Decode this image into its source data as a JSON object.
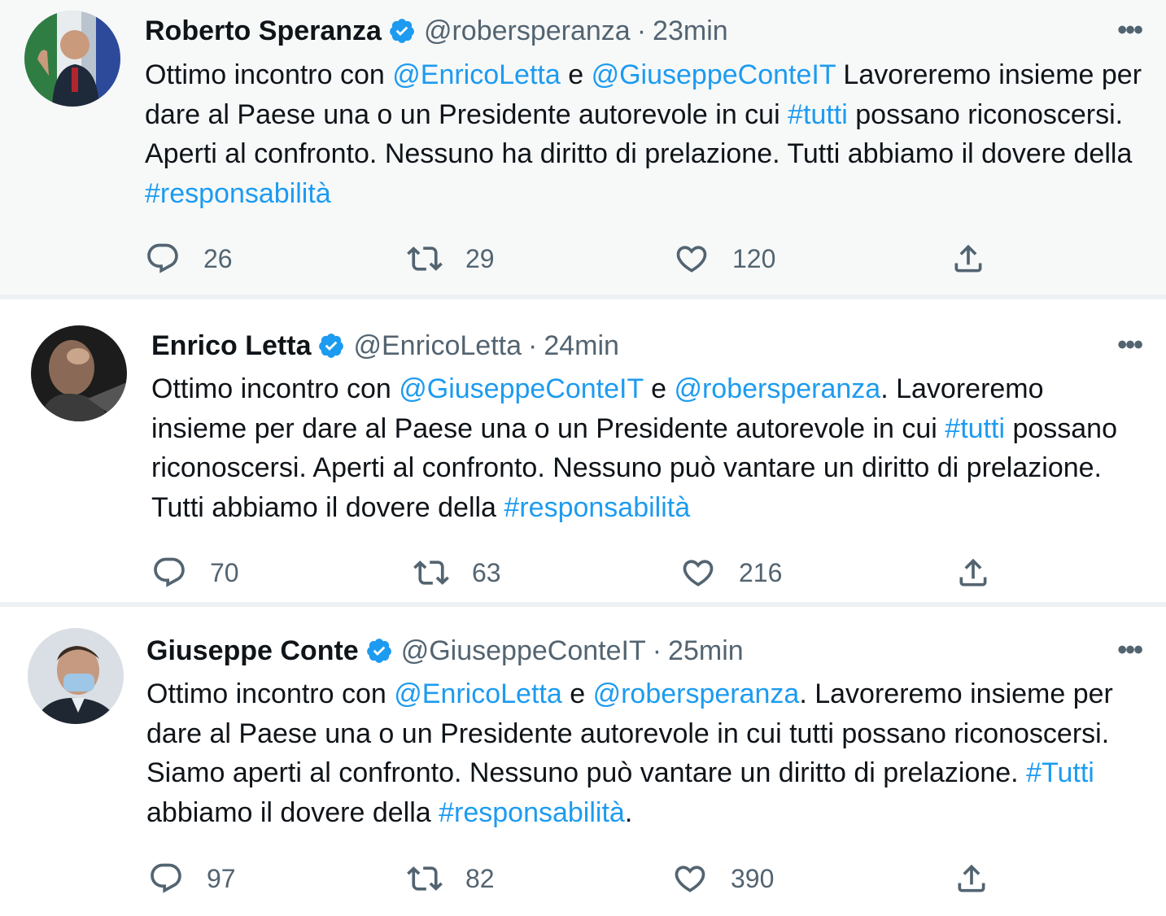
{
  "accent": "#1d9bf0",
  "tweets": [
    {
      "name": "Roberto Speranza",
      "handle": "@robersperanza",
      "separator": "·",
      "time": "23min",
      "text": {
        "p1": "Ottimo incontro con ",
        "l1": "@EnricoLetta",
        "p2": " e ",
        "l2": "@GiuseppeConteIT",
        "p3": " Lavoreremo insieme per dare al Paese una o un Presidente autorevole in cui ",
        "l3": "#tutti",
        "p4": " possano riconoscersi. Aperti al confronto. Nessuno ha diritto di prelazione. Tutti abbiamo il dovere della ",
        "l4": "#responsabilità",
        "p5": ""
      },
      "replies": "26",
      "retweets": "29",
      "likes": "120"
    },
    {
      "name": "Enrico Letta",
      "handle": "@EnricoLetta",
      "separator": "·",
      "time": "24min",
      "text": {
        "p1": "Ottimo incontro con ",
        "l1": "@GiuseppeConteIT",
        "p2": " e ",
        "l2": "@robersperanza",
        "p3": ". Lavoreremo insieme per dare al Paese una o un Presidente autorevole in cui ",
        "l3": "#tutti",
        "p4": " possano riconoscersi. Aperti al confronto. Nessuno può vantare un diritto di prelazione. Tutti abbiamo il dovere della ",
        "l4": "#responsabilità",
        "p5": ""
      },
      "replies": "70",
      "retweets": "63",
      "likes": "216"
    },
    {
      "name": "Giuseppe Conte",
      "handle": "@GiuseppeConteIT",
      "separator": "·",
      "time": "25min",
      "text": {
        "p1": "Ottimo incontro con ",
        "l1": "@EnricoLetta",
        "p2": " e ",
        "l2": "@robersperanza",
        "p3": ". Lavoreremo insieme per dare al Paese una o un Presidente autorevole in cui tutti possano riconoscersi. Siamo aperti al confronto. Nessuno può vantare un diritto di prelazione. ",
        "l3": "#Tutti",
        "p4": " abbiamo il dovere della ",
        "l4": "#responsabilità",
        "p5": "."
      },
      "replies": "97",
      "retweets": "82",
      "likes": "390"
    }
  ],
  "more_label": "•••",
  "icons": {
    "reply": "reply-icon",
    "retweet": "retweet-icon",
    "like": "like-icon",
    "share": "share-icon",
    "verified": "verified-badge-icon",
    "more": "more-options-icon"
  }
}
